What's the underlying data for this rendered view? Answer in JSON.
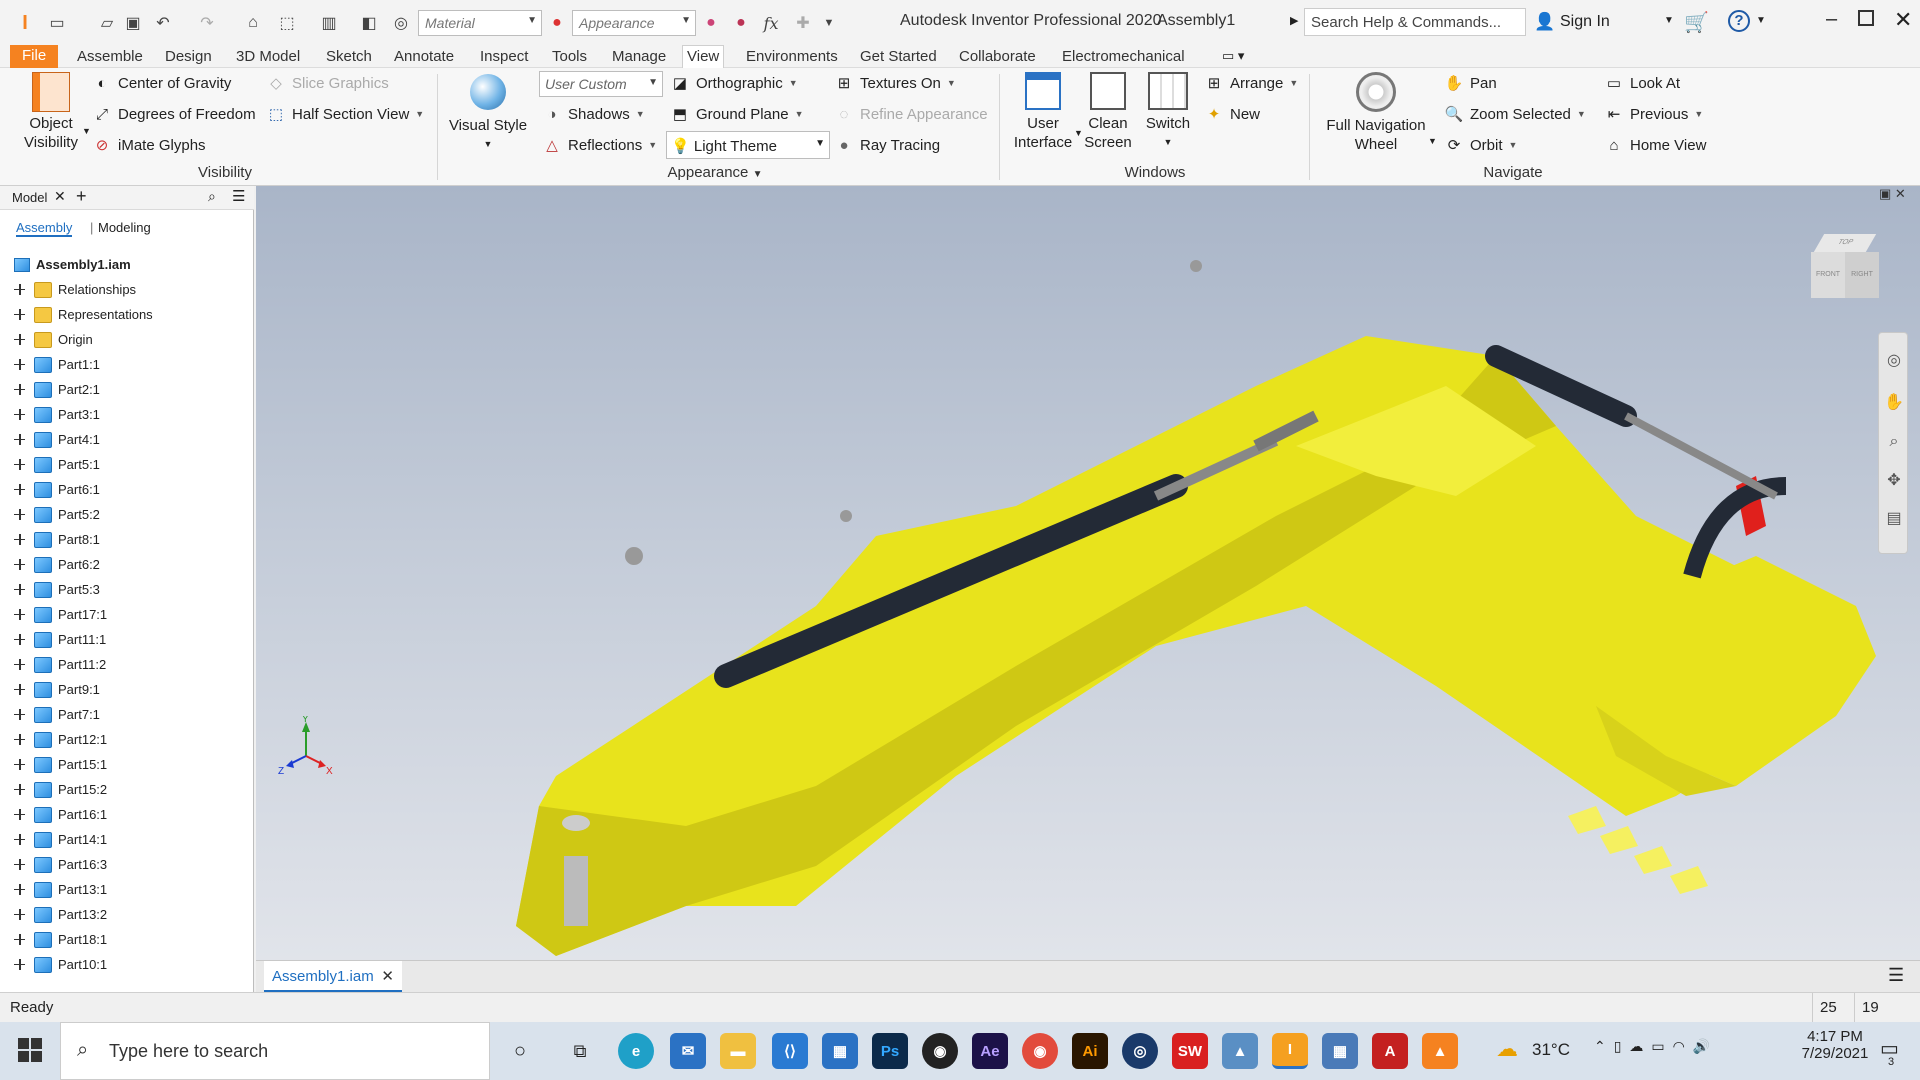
{
  "titlebar": {
    "app_title": "Autodesk Inventor Professional 2020",
    "doc_title": "Assembly1",
    "material_placeholder": "Material",
    "appearance_placeholder": "Appearance",
    "search_placeholder": "Search Help & Commands...",
    "sign_in": "Sign In",
    "fx": "fx"
  },
  "menu": [
    "File",
    "Assemble",
    "Design",
    "3D Model",
    "Sketch",
    "Annotate",
    "Inspect",
    "Tools",
    "Manage",
    "View",
    "Environments",
    "Get Started",
    "Collaborate",
    "Electromechanical"
  ],
  "ribbon": {
    "visibility": {
      "object_visibility": [
        "Object",
        "Visibility"
      ],
      "center_of_gravity": "Center of Gravity",
      "degrees_of_freedom": "Degrees of Freedom",
      "imate_glyphs": "iMate Glyphs",
      "slice_graphics": "Slice Graphics",
      "half_section_view": "Half Section View",
      "label": "Visibility"
    },
    "appearance": {
      "visual_style": "Visual Style",
      "user_custom": "User Custom",
      "shadows": "Shadows",
      "reflections": "Reflections",
      "orthographic": "Orthographic",
      "ground_plane": "Ground Plane",
      "light_theme": "Light Theme",
      "textures_on": "Textures On",
      "refine_appearance": "Refine Appearance",
      "ray_tracing": "Ray Tracing",
      "label": "Appearance"
    },
    "windows": {
      "user_interface": [
        "User",
        "Interface"
      ],
      "clean_screen": [
        "Clean",
        "Screen"
      ],
      "switch": "Switch",
      "arrange": "Arrange",
      "new": "New",
      "label": "Windows"
    },
    "navigate": {
      "full_navigation_wheel": [
        "Full Navigation",
        "Wheel"
      ],
      "pan": "Pan",
      "zoom_selected": "Zoom Selected",
      "orbit": "Orbit",
      "look_at": "Look At",
      "previous": "Previous",
      "home_view": "Home View",
      "label": "Navigate"
    }
  },
  "browser": {
    "panel_title": "Model",
    "tab_assembly": "Assembly",
    "tab_modeling": "Modeling",
    "root": "Assembly1.iam",
    "items": [
      {
        "label": "Relationships",
        "icon": "folder"
      },
      {
        "label": "Representations",
        "icon": "folder"
      },
      {
        "label": "Origin",
        "icon": "folder"
      },
      {
        "label": "Part1:1",
        "icon": "part"
      },
      {
        "label": "Part2:1",
        "icon": "part"
      },
      {
        "label": "Part3:1",
        "icon": "part"
      },
      {
        "label": "Part4:1",
        "icon": "part"
      },
      {
        "label": "Part5:1",
        "icon": "part"
      },
      {
        "label": "Part6:1",
        "icon": "part"
      },
      {
        "label": "Part5:2",
        "icon": "part"
      },
      {
        "label": "Part8:1",
        "icon": "part"
      },
      {
        "label": "Part6:2",
        "icon": "part"
      },
      {
        "label": "Part5:3",
        "icon": "part"
      },
      {
        "label": "Part17:1",
        "icon": "part"
      },
      {
        "label": "Part11:1",
        "icon": "part"
      },
      {
        "label": "Part11:2",
        "icon": "part"
      },
      {
        "label": "Part9:1",
        "icon": "part"
      },
      {
        "label": "Part7:1",
        "icon": "part"
      },
      {
        "label": "Part12:1",
        "icon": "part"
      },
      {
        "label": "Part15:1",
        "icon": "part"
      },
      {
        "label": "Part15:2",
        "icon": "part"
      },
      {
        "label": "Part16:1",
        "icon": "part"
      },
      {
        "label": "Part14:1",
        "icon": "part"
      },
      {
        "label": "Part16:3",
        "icon": "part"
      },
      {
        "label": "Part13:1",
        "icon": "part"
      },
      {
        "label": "Part13:2",
        "icon": "part"
      },
      {
        "label": "Part18:1",
        "icon": "part"
      },
      {
        "label": "Part10:1",
        "icon": "part"
      }
    ]
  },
  "viewcube": {
    "top": "TOP",
    "front": "FRONT",
    "right": "RIGHT"
  },
  "triad": {
    "x": "X",
    "y": "Y",
    "z": "Z"
  },
  "doc_tab": "Assembly1.iam",
  "status": {
    "text": "Ready",
    "num1": "25",
    "num2": "19"
  },
  "taskbar": {
    "search_placeholder": "Type here to search",
    "temperature": "31°C",
    "time": "4:17 PM",
    "date": "7/29/2021",
    "notification_count": "3",
    "apps": [
      "Ps",
      "Ae",
      "Ai",
      "SW"
    ]
  },
  "colors": {
    "accent": "#f58220",
    "model_yellow": "#e6e01c",
    "cylinder": "#232a36",
    "red": "#e0201c"
  }
}
